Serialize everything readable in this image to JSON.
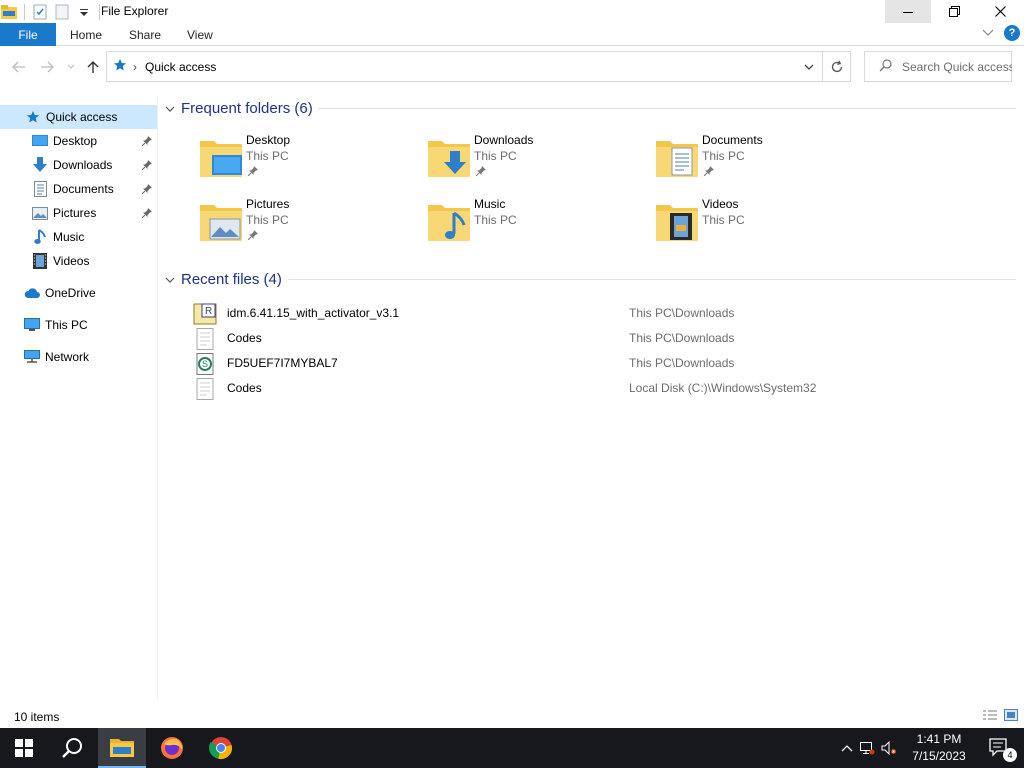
{
  "window": {
    "title": "File Explorer"
  },
  "ribbon": {
    "tabs": [
      {
        "label": "File"
      },
      {
        "label": "Home"
      },
      {
        "label": "Share"
      },
      {
        "label": "View"
      }
    ],
    "help": "?"
  },
  "address_bar": {
    "breadcrumb": "Quick access",
    "separator": "›"
  },
  "search": {
    "placeholder": "Search Quick access"
  },
  "nav_pane": {
    "items": [
      {
        "label": "Quick access",
        "icon": "star-icon",
        "selected": true
      },
      {
        "label": "Desktop",
        "icon": "desktop-folder-icon",
        "pinned": true
      },
      {
        "label": "Downloads",
        "icon": "download-arrow-icon",
        "pinned": true
      },
      {
        "label": "Documents",
        "icon": "documents-icon",
        "pinned": true
      },
      {
        "label": "Pictures",
        "icon": "pictures-icon",
        "pinned": true
      },
      {
        "label": "Music",
        "icon": "music-note-icon"
      },
      {
        "label": "Videos",
        "icon": "videos-icon"
      },
      {
        "label": "OneDrive",
        "icon": "cloud-icon"
      },
      {
        "label": "This PC",
        "icon": "computer-icon"
      },
      {
        "label": "Network",
        "icon": "network-icon"
      }
    ]
  },
  "frequent_folders": {
    "header": "Frequent folders (6)",
    "items": [
      {
        "name": "Desktop",
        "location": "This PC",
        "pinned": true,
        "icon": "desktop-folder-icon"
      },
      {
        "name": "Downloads",
        "location": "This PC",
        "pinned": true,
        "icon": "downloads-folder-icon"
      },
      {
        "name": "Documents",
        "location": "This PC",
        "pinned": true,
        "icon": "documents-folder-icon"
      },
      {
        "name": "Pictures",
        "location": "This PC",
        "pinned": true,
        "icon": "pictures-folder-icon"
      },
      {
        "name": "Music",
        "location": "This PC",
        "pinned": false,
        "icon": "music-folder-icon"
      },
      {
        "name": "Videos",
        "location": "This PC",
        "pinned": false,
        "icon": "videos-folder-icon"
      }
    ]
  },
  "recent_files": {
    "header": "Recent files (4)",
    "items": [
      {
        "name": "idm.6.41.15_with_activator_v3.1",
        "path": "This PC\\Downloads",
        "icon": "winrar-archive-icon"
      },
      {
        "name": "Codes",
        "path": "This PC\\Downloads",
        "icon": "text-file-icon"
      },
      {
        "name": "FD5UEF7I7MYBAL7",
        "path": "This PC\\Downloads",
        "icon": "script-file-icon"
      },
      {
        "name": "Codes",
        "path": "Local Disk (C:)\\Windows\\System32",
        "icon": "text-file-icon"
      }
    ]
  },
  "status_bar": {
    "item_count": "10 items"
  },
  "taskbar": {
    "time": "1:41 PM",
    "date": "7/15/2023",
    "notification_count": "4"
  },
  "colors": {
    "accent": "#1979ca",
    "selection": "#cce8ff",
    "header_text": "#1e3287",
    "taskbar": "#16181d"
  }
}
